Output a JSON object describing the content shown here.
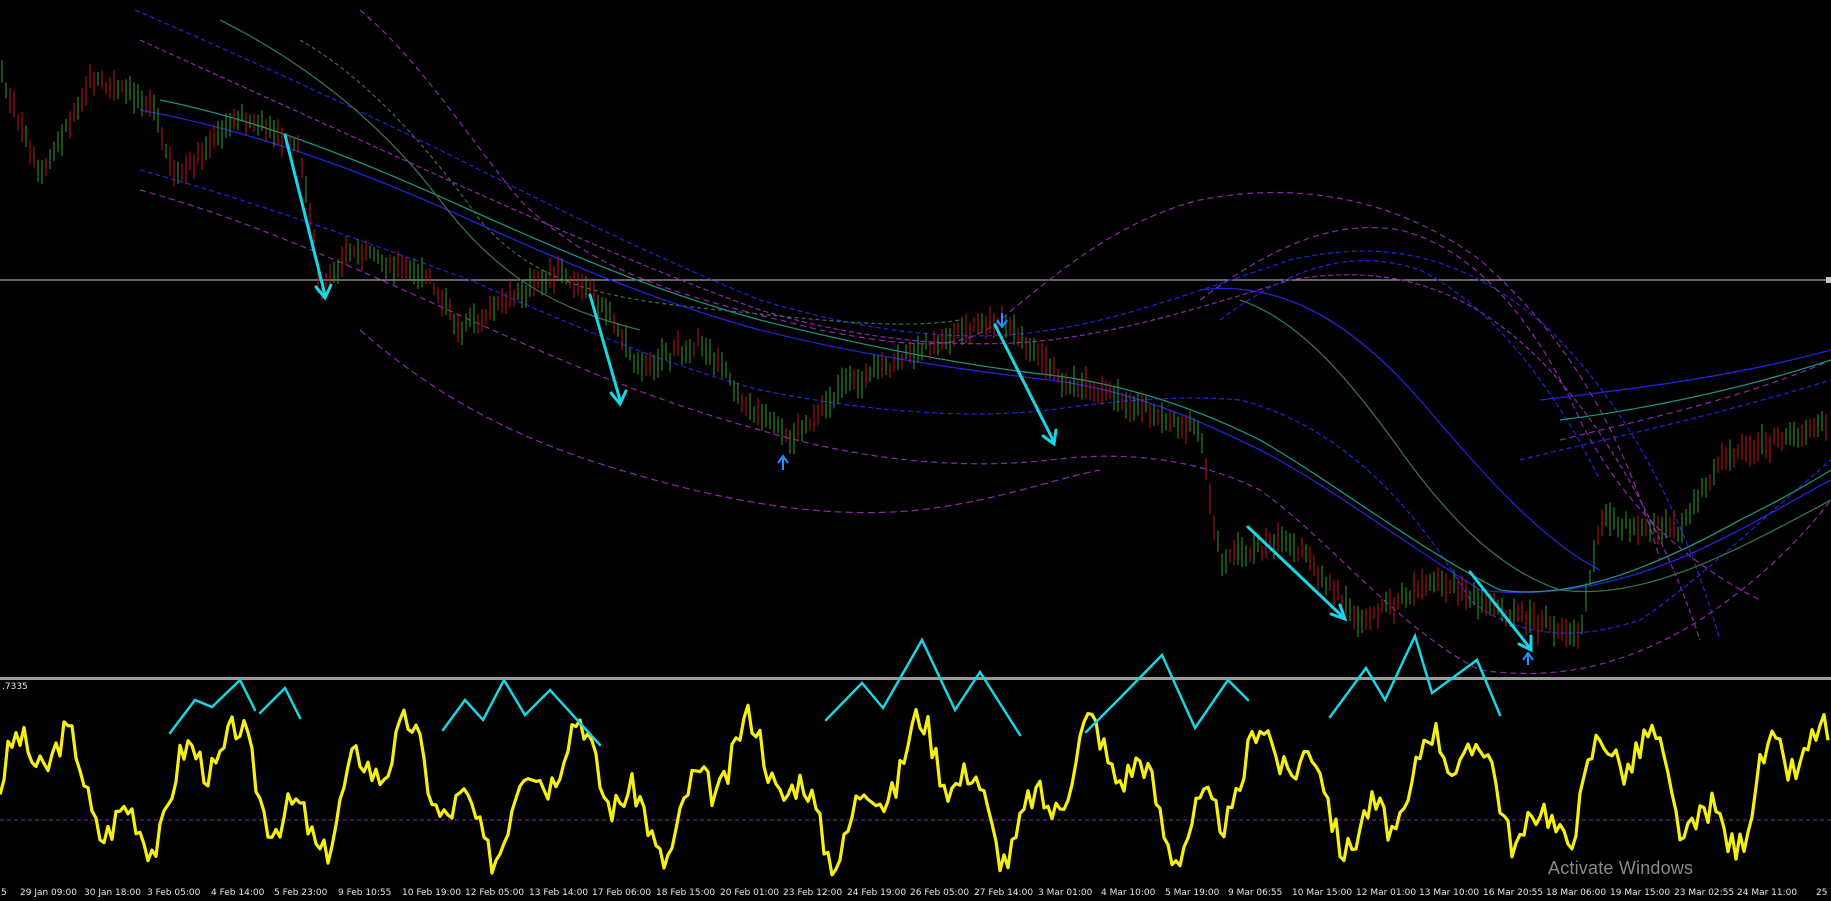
{
  "colors": {
    "background": "#000000",
    "candle_up": "#2f9b2f",
    "candle_down": "#c01818",
    "oscillator": "#f5f011",
    "annotation": "#19d6e6",
    "band_blue": "#2323d8",
    "band_purple": "#8a2aa8",
    "band_teal": "#1f8f7e",
    "band_green": "#3b6f4b",
    "signal_arrow": "#1e90ff",
    "divider": "#9a9a9a"
  },
  "indicator": {
    "value_label": ".7335"
  },
  "watermark": {
    "text": "Activate Windows"
  },
  "time_axis": [
    "29 Jan 09:00",
    "30 Jan 18:00",
    "3 Feb 05:00",
    "4 Feb 14:00",
    "5 Feb 23:00",
    "9 Feb 10:55",
    "10 Feb 19:00",
    "12 Feb 05:00",
    "13 Feb 14:00",
    "17 Feb 06:00",
    "18 Feb 15:00",
    "20 Feb 01:00",
    "23 Feb 12:00",
    "24 Feb 19:00",
    "26 Feb 05:00",
    "27 Feb 14:00",
    "3 Mar 01:00",
    "4 Mar 10:00",
    "5 Mar 19:00",
    "9 Mar 06:55",
    "10 Mar 15:00",
    "12 Mar 01:00",
    "13 Mar 10:00",
    "16 Mar 20:55",
    "18 Mar 06:00",
    "19 Mar 15:00",
    "23 Mar 02:55",
    "24 Mar 11:00"
  ],
  "time_axis_edge_left": "5",
  "time_axis_edge_right": "25"
}
